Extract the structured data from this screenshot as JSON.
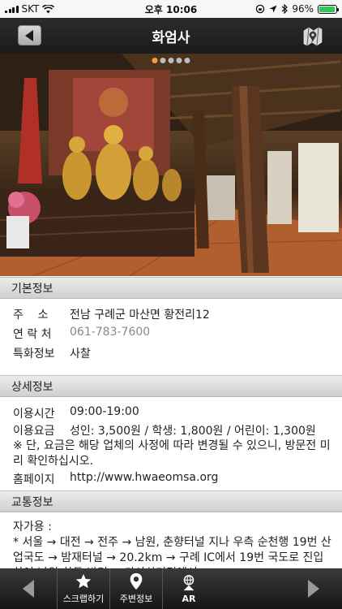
{
  "status_bar": {
    "carrier": "SKT",
    "time": "오후 10:06",
    "battery": "96%",
    "battery_level": 0.96
  },
  "header": {
    "title": "화엄사",
    "icons": {
      "back": "back-arrow-icon",
      "map": "map-icon"
    }
  },
  "hero": {
    "photo": "temple-interior-photo",
    "page_count": 5,
    "active_page": 1
  },
  "basic_info": {
    "title": "기본정보",
    "rows": [
      {
        "label": "주    소",
        "value": "전남 구례군 마산면 황전리12"
      },
      {
        "label": "연 락 처",
        "value": "061-783-7600"
      },
      {
        "label": "특화정보",
        "value": "사찰"
      }
    ]
  },
  "detail_info": {
    "title": "상세정보",
    "hours_label": "이용시간",
    "hours_value": "09:00-19:00",
    "fee_label": "이용요금",
    "fee_value": "성인: 3,500원 / 학생: 1,800원 / 어린이: 1,300원",
    "note": "※ 단, 요금은 해당 업체의 사정에 따라 변경될 수 있으니, 방문전 미리 확인하십시오.",
    "homepage_label": "홈페이지",
    "homepage_value": "http://www.hwaeomsa.org"
  },
  "transport": {
    "title": "교통정보",
    "subtitle": "자가용 :",
    "text": "* 서울 → 대전 → 전주 → 남원, 춘향터널 지나 우측 순천행 19번 산업국도 → 밤재터널 → 20.2km → 구례 IC에서 19번 국도로 진입하여 남원-하동 방면 → 마산삼거리에서"
  },
  "toolbar": {
    "scrap_label": "스크랩하기",
    "nearby_label": "주변정보",
    "ar_label": "AR"
  },
  "colors": {
    "title_bar": "#1b1b1b",
    "accent_dot": "#f0a030",
    "phone_link": "#888888"
  }
}
